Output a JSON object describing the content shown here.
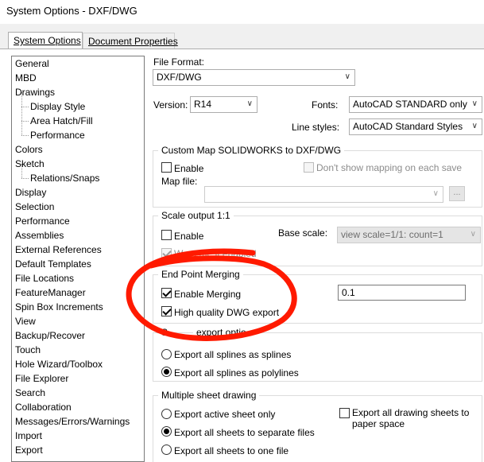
{
  "window": {
    "title": "System Options - DXF/DWG"
  },
  "tabs": [
    {
      "label": "System Options",
      "active": true
    },
    {
      "label": "Document Properties",
      "active": false
    }
  ],
  "tree": [
    {
      "label": "General",
      "level": 0
    },
    {
      "label": "MBD",
      "level": 0
    },
    {
      "label": "Drawings",
      "level": 0
    },
    {
      "label": "Display Style",
      "level": 1
    },
    {
      "label": "Area Hatch/Fill",
      "level": 1
    },
    {
      "label": "Performance",
      "level": 1
    },
    {
      "label": "Colors",
      "level": 0
    },
    {
      "label": "Sketch",
      "level": 0
    },
    {
      "label": "Relations/Snaps",
      "level": 1
    },
    {
      "label": "Display",
      "level": 0
    },
    {
      "label": "Selection",
      "level": 0
    },
    {
      "label": "Performance",
      "level": 0
    },
    {
      "label": "Assemblies",
      "level": 0
    },
    {
      "label": "External References",
      "level": 0
    },
    {
      "label": "Default Templates",
      "level": 0
    },
    {
      "label": "File Locations",
      "level": 0
    },
    {
      "label": "FeatureManager",
      "level": 0
    },
    {
      "label": "Spin Box Increments",
      "level": 0
    },
    {
      "label": "View",
      "level": 0
    },
    {
      "label": "Backup/Recover",
      "level": 0
    },
    {
      "label": "Touch",
      "level": 0
    },
    {
      "label": "Hole Wizard/Toolbox",
      "level": 0
    },
    {
      "label": "File Explorer",
      "level": 0
    },
    {
      "label": "Search",
      "level": 0
    },
    {
      "label": "Collaboration",
      "level": 0
    },
    {
      "label": "Messages/Errors/Warnings",
      "level": 0
    },
    {
      "label": "Import",
      "level": 0
    },
    {
      "label": "Export",
      "level": 0
    }
  ],
  "file_format": {
    "label": "File Format:",
    "value": "DXF/DWG"
  },
  "version": {
    "label": "Version:",
    "value": "R14"
  },
  "fonts": {
    "label": "Fonts:",
    "value": "AutoCAD STANDARD only"
  },
  "line_styles": {
    "label": "Line styles:",
    "value": "AutoCAD Standard Styles"
  },
  "custom_map": {
    "title": "Custom Map SOLIDWORKS to DXF/DWG",
    "enable_label": "Enable",
    "enable_checked": false,
    "dont_show_label": "Don't show mapping on each save",
    "dont_show_checked": false,
    "map_file_label": "Map file:",
    "map_file_value": "",
    "browse_label": "..."
  },
  "scale_output": {
    "title": "Scale output 1:1",
    "enable_label": "Enable",
    "enable_checked": false,
    "base_scale_label": "Base scale:",
    "base_scale_value": "view scale=1/1: count=1",
    "warn_label": "Warn me if enabled",
    "warn_checked": true
  },
  "end_point_merging": {
    "title": "End Point Merging",
    "enable_label": "Enable Merging",
    "enable_checked": true,
    "merge_value": "0.1",
    "hq_label": "High quality DWG export",
    "hq_checked": true
  },
  "spline_export": {
    "title_visible": "S",
    "title_visible_end": "export optio",
    "opt1": "Export all splines as splines",
    "opt2": "Export all splines as polylines",
    "selected": 2
  },
  "multi_sheet": {
    "title": "Multiple sheet drawing",
    "opt1": "Export active sheet only",
    "opt2": "Export all sheets to separate files",
    "opt3": "Export all sheets to one file",
    "selected": 2,
    "paper_space_label": "Export all drawing sheets to paper space",
    "paper_space_checked": false
  },
  "colors": {
    "annotation_red": "#ff1a00",
    "border": "#adadad"
  }
}
